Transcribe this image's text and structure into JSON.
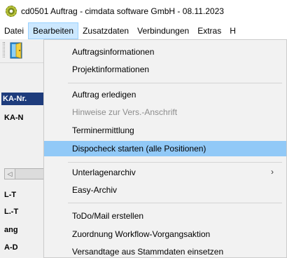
{
  "window": {
    "title": "cd0501 Auftrag - cimdata software GmbH - 08.11.2023"
  },
  "menubar": {
    "items": [
      {
        "label": "Datei"
      },
      {
        "label": "Bearbeiten"
      },
      {
        "label": "Zusatzdaten"
      },
      {
        "label": "Verbindungen"
      },
      {
        "label": "Extras"
      },
      {
        "label": "H"
      }
    ]
  },
  "background": {
    "ka_header": "KA-Nr.",
    "ka_label": "KA-N",
    "rows": [
      "L-T",
      "L.-T",
      "ang",
      "A-D"
    ],
    "scroll_left_glyph": "◁"
  },
  "dropdown": {
    "items": [
      {
        "label": "Auftragsinformationen"
      },
      {
        "label": "Projektinformationen"
      },
      {
        "label": "Auftrag erledigen"
      },
      {
        "label": "Hinweise zur Vers.-Anschrift"
      },
      {
        "label": "Terminermittlung"
      },
      {
        "label": "Dispocheck starten (alle Positionen)"
      },
      {
        "label": "Unterlagenarchiv",
        "submenu_glyph": "›"
      },
      {
        "label": "Easy-Archiv"
      },
      {
        "label": "ToDo/Mail erstellen"
      },
      {
        "label": "Zuordnung Workflow-Vorgangsaktion"
      },
      {
        "label": "Versandtage aus Stammdaten einsetzen"
      }
    ]
  }
}
